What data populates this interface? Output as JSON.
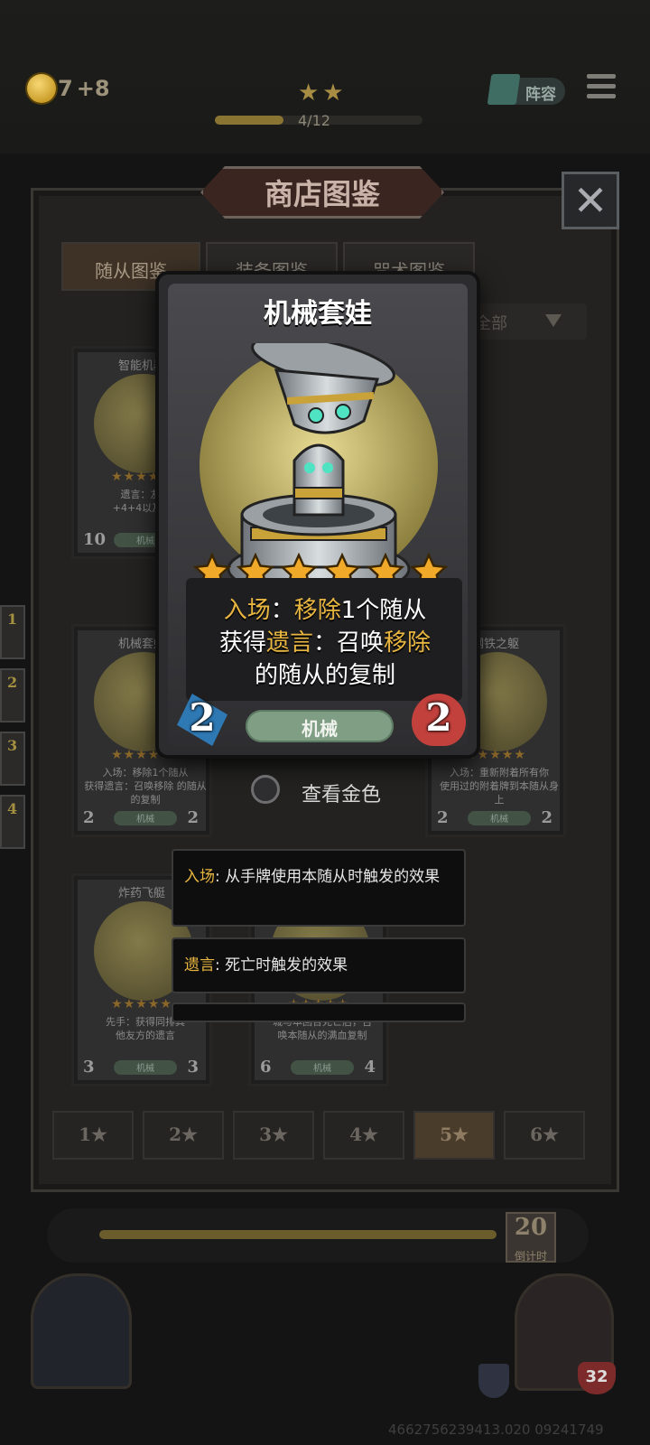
{
  "hud": {
    "gold": "7",
    "gold_income": "+8",
    "tier_stars": "★★",
    "xp_text": "4/12",
    "xp_fraction": 0.33,
    "lineup_label": "阵容"
  },
  "modal": {
    "title": "商店图鉴",
    "close_glyph": "✕",
    "tabs": [
      "随从图鉴",
      "装备图鉴",
      "咒术图鉴"
    ],
    "filter_label": "全部"
  },
  "grid_cards": [
    {
      "name": "智能机器",
      "stars": "★★★★★",
      "desc1": "遗言：友方",
      "desc2": "+4+4以及4层",
      "atk": "10",
      "hp": "",
      "tribe": "机械"
    },
    {
      "name": "机械套娃",
      "stars": "★★★★★",
      "desc1": "入场：移除1个随从",
      "desc2": "获得遗言：召唤移除 的随从的复制",
      "atk": "2",
      "hp": "2",
      "tribe": "机械"
    },
    {
      "name": "钢铁之躯",
      "stars": "★★★★★",
      "desc1": "入场：重新附着所有你",
      "desc2": "使用过的附着牌到本随从身上",
      "atk": "2",
      "hp": "2",
      "tribe": "机械"
    },
    {
      "name": "炸药飞艇",
      "stars": "★★★★★",
      "desc1": "先手：获得同排其",
      "desc2": "他友方的遗言",
      "atk": "3",
      "hp": "3",
      "tribe": "机械"
    },
    {
      "name": "",
      "stars": "★★★★★",
      "desc1": "城与本回合死亡后，召",
      "desc2": "唤本随从的满血复制",
      "atk": "6",
      "hp": "4",
      "tribe": "机械"
    }
  ],
  "star_tabs": [
    "1★",
    "2★",
    "3★",
    "4★",
    "5★",
    "6★"
  ],
  "active_star_tab": 4,
  "card": {
    "name": "机械套娃",
    "stars": 6,
    "desc_line1_pre": "入场",
    "desc_line1_sep": "：",
    "desc_line1_kw": "移除",
    "desc_line1_post": "1个随从",
    "desc_line2_pre": "获得",
    "desc_line2_kw1": "遗言",
    "desc_line2_mid": "：召唤",
    "desc_line2_kw2": "移除",
    "desc_line3": "的随从的复制",
    "attack": "2",
    "health": "2",
    "tribe": "机械"
  },
  "golden_toggle_label": "查看金色",
  "tooltips": [
    {
      "keyword": "入场",
      "text": ": 从手牌使用本随从时触发的效果"
    },
    {
      "keyword": "遗言",
      "text": ": 死亡时触发的效果"
    }
  ],
  "left_slots": [
    "1",
    "2",
    "3",
    "4"
  ],
  "timer": {
    "value": "20",
    "label": "倒计时"
  },
  "player_hp": "32",
  "version": "4662756239413.020 09241749",
  "colors": {
    "keyword": "#e8b640",
    "tribe": "#7f9e84",
    "attack": "#2e78b3",
    "health": "#c2413d"
  }
}
